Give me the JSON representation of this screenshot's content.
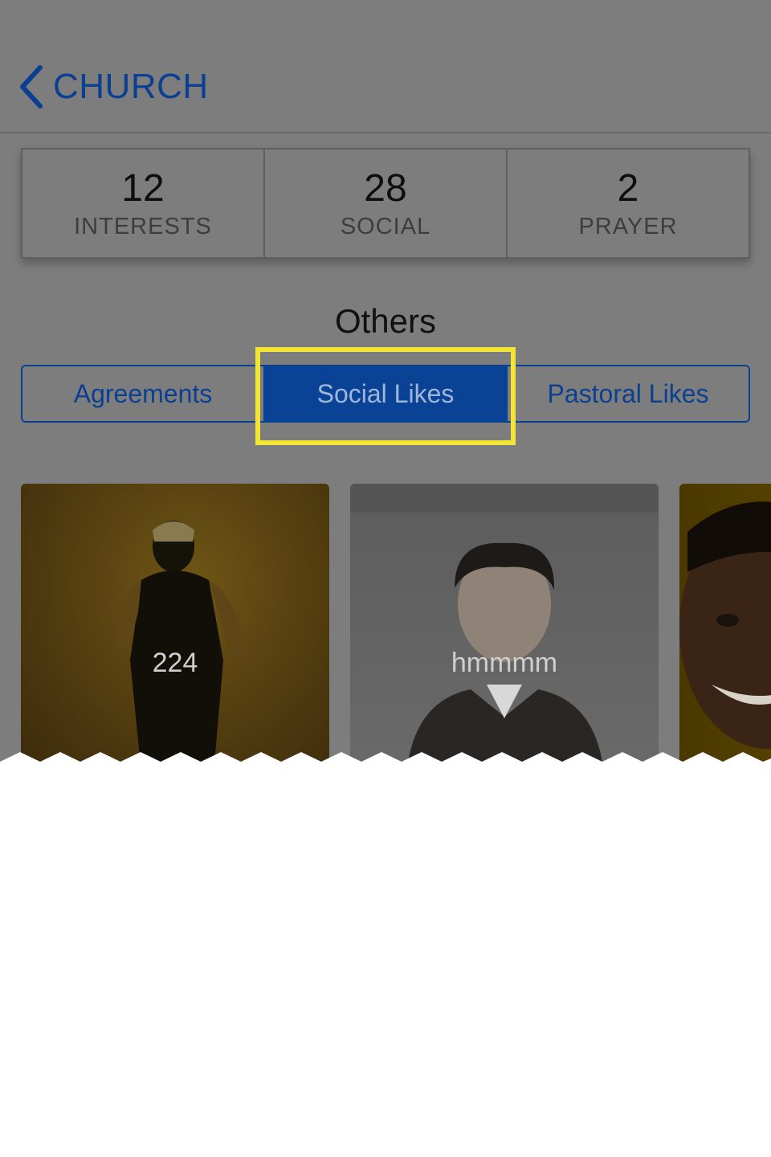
{
  "nav": {
    "back_label": "CHURCH"
  },
  "stats": [
    {
      "value": "12",
      "label": "INTERESTS"
    },
    {
      "value": "28",
      "label": "SOCIAL"
    },
    {
      "value": "2",
      "label": "PRAYER"
    }
  ],
  "section_title": "Others",
  "segments": [
    {
      "label": "Agreements",
      "active": false
    },
    {
      "label": "Social Likes",
      "active": true
    },
    {
      "label": "Pastoral Likes",
      "active": false
    }
  ],
  "cards": [
    {
      "label": "224"
    },
    {
      "label": "hmmmm"
    },
    {
      "label": ""
    }
  ],
  "colors": {
    "accent": "#0b3f91",
    "highlight": "#f2e536",
    "overlay": "#7d7d7d"
  }
}
